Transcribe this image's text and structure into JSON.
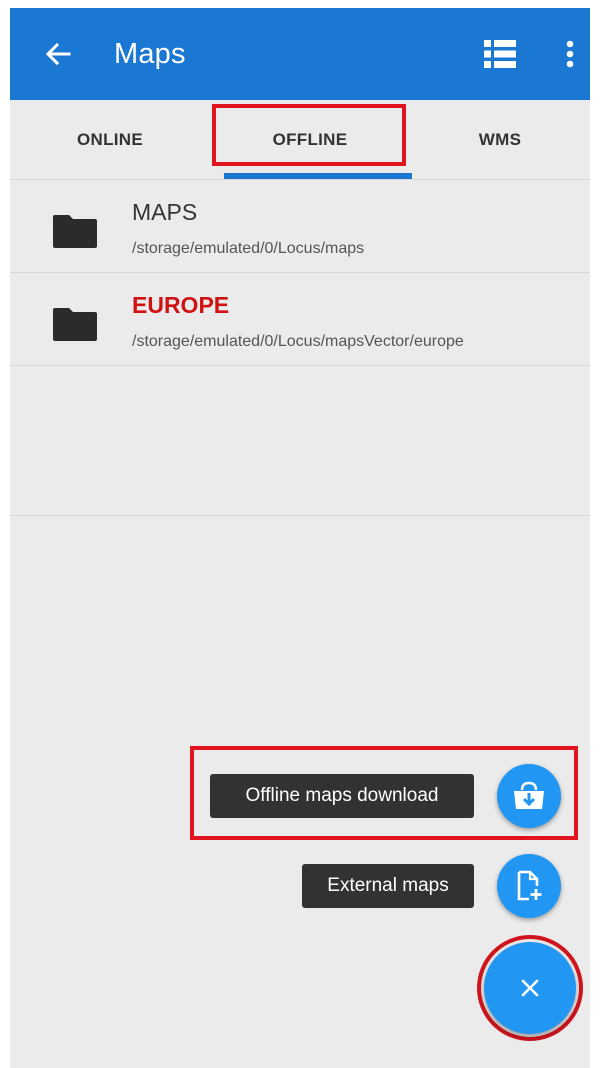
{
  "appbar": {
    "title": "Maps",
    "back_icon": "arrow-left-icon",
    "list_icon": "list-view-icon",
    "more_icon": "more-vert-icon",
    "color": "#1a77d2"
  },
  "tabs": [
    {
      "label": "ONLINE",
      "selected": false
    },
    {
      "label": "OFFLINE",
      "selected": true
    },
    {
      "label": "WMS",
      "selected": false
    }
  ],
  "folders": [
    {
      "name": "MAPS",
      "path": "/storage/emulated/0/Locus/maps",
      "icon": "folder-icon"
    },
    {
      "name": "EUROPE",
      "path": "/storage/emulated/0/Locus/mapsVector/europe",
      "icon": "folder-icon",
      "highlight_color": "#d01212"
    }
  ],
  "fab_menu": {
    "download_label": "Offline maps download",
    "download_icon": "store-download-icon",
    "external_label": "External maps",
    "external_icon": "file-add-icon",
    "close_icon": "close-icon",
    "fab_color": "#2196f3"
  },
  "annotation_color": "#e0141e"
}
